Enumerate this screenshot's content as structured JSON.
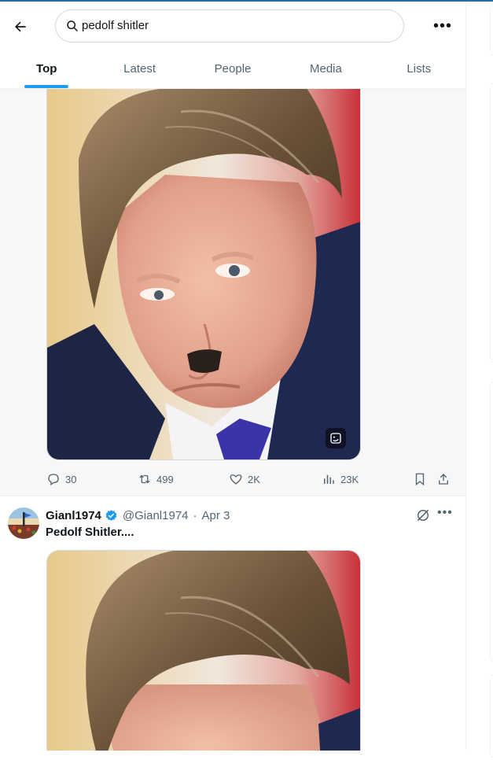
{
  "search": {
    "query": "pedolf shitler",
    "more_label": "•••"
  },
  "tabs": [
    {
      "label": "Top",
      "active": true
    },
    {
      "label": "Latest",
      "active": false
    },
    {
      "label": "People",
      "active": false
    },
    {
      "label": "Media",
      "active": false
    },
    {
      "label": "Lists",
      "active": false
    }
  ],
  "tweet1": {
    "media_icon": "sticker-edit-icon",
    "replies": "30",
    "reposts": "499",
    "likes": "2K",
    "views": "23K"
  },
  "tweet2": {
    "display_name": "Gianl1974",
    "handle": "@Gianl1974",
    "date_sep": "·",
    "date": "Apr 3",
    "text": "Pedolf Shitler....",
    "more_label": "•••"
  },
  "colors": {
    "accent": "#1d9bf0",
    "muted": "#536471",
    "text": "#0f1419"
  }
}
